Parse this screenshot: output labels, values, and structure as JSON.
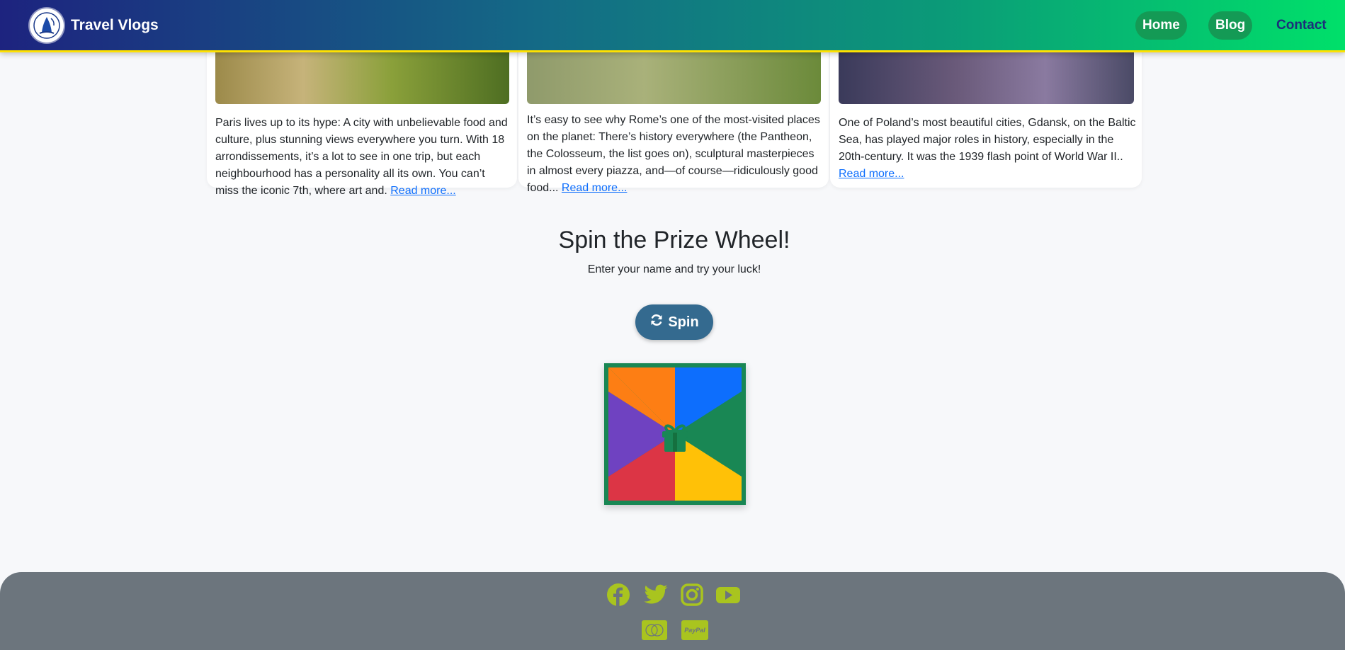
{
  "header": {
    "brand": "Travel Vlogs",
    "nav": [
      {
        "label": "Home"
      },
      {
        "label": "Blog"
      },
      {
        "label": "Contact"
      }
    ]
  },
  "cards": [
    {
      "text": "Paris lives up to its hype: A city with unbelievable food and culture, plus stunning views everywhere you turn. With 18 arrondissements, it’s a lot to see in one trip, but each neighbourhood has a personality all its own. You can’t miss the iconic 7th, where art and.",
      "link": "Read more..."
    },
    {
      "text": "It’s easy to see why Rome’s one of the most-visited places on the planet: There’s history everywhere (the Pantheon, the Colosseum, the list goes on), sculptural masterpieces in almost every piazza, and—of course—ridiculously good food...",
      "link": "Read more..."
    },
    {
      "text": "One of Poland’s most beautiful cities, Gdansk, on the Baltic Sea, has played major roles in history, especially in the 20th-century. It was the 1939 flash point of World War II..",
      "link": "Read more..."
    }
  ],
  "prize": {
    "title": "Spin the Prize Wheel!",
    "subtitle": "Enter your name and try your luck!",
    "button": "Spin",
    "wheel_colors": [
      "#fd7e14",
      "#0d6efd",
      "#198754",
      "#ffc107",
      "#dc3545",
      "#6f42c1"
    ],
    "frame_color": "#198754"
  },
  "footer": {
    "social_icons": [
      "facebook-icon",
      "twitter-icon",
      "instagram-icon",
      "youtube-icon"
    ],
    "payment_icons": [
      "mastercard-icon",
      "paypal-icon"
    ],
    "paypal_text": "PayPal",
    "icon_color": "#a9c41f"
  }
}
